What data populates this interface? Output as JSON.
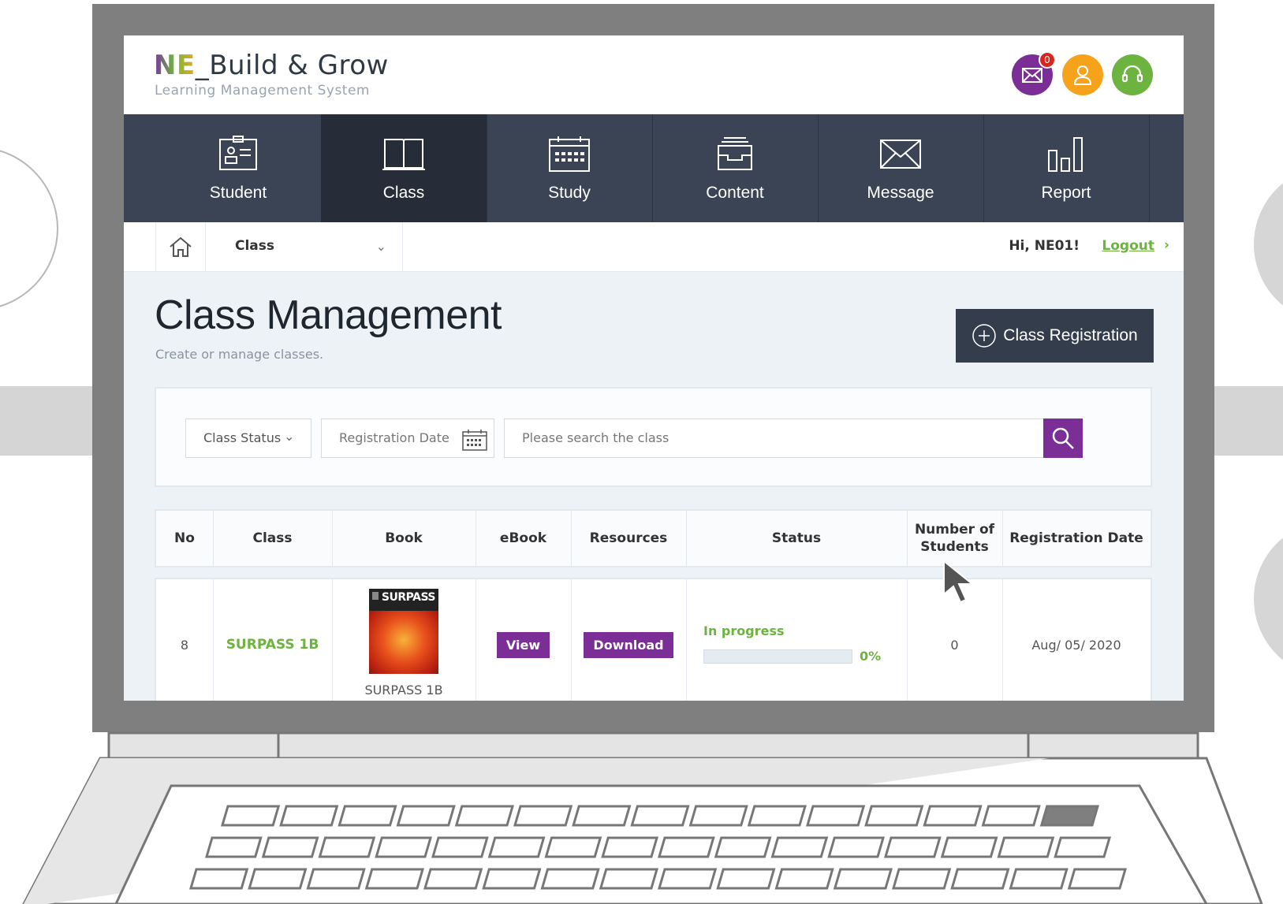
{
  "brand": {
    "logo_mark": "NE",
    "logo_title": "_Build & Grow",
    "logo_subtitle": "Learning Management System",
    "mail_badge_count": "0",
    "colors": {
      "mail": "#7a2e96",
      "profile": "#f7a21b",
      "support": "#6db33f"
    }
  },
  "nav": {
    "items": [
      {
        "label": "Student",
        "icon": "student-card-icon"
      },
      {
        "label": "Class",
        "icon": "book-icon"
      },
      {
        "label": "Study",
        "icon": "calendar-icon"
      },
      {
        "label": "Content",
        "icon": "inbox-tray-icon"
      },
      {
        "label": "Message",
        "icon": "envelope-icon"
      },
      {
        "label": "Report",
        "icon": "bar-chart-icon"
      }
    ],
    "active": "Class"
  },
  "breadcrumb": {
    "current": "Class",
    "greeting": "Hi, NE01!",
    "logout": "Logout"
  },
  "page": {
    "title": "Class Management",
    "subtitle": "Create or manage classes.",
    "register_button": "Class Registration"
  },
  "filters": {
    "status_label": "Class Status",
    "date_label": "Registration Date",
    "search_placeholder": "Please search the class"
  },
  "table": {
    "headers": [
      "No",
      "Class",
      "Book",
      "eBook",
      "Resources",
      "Status",
      "Number of Students",
      "Registration Date"
    ],
    "rows": [
      {
        "no": "8",
        "class": "SURPASS 1B",
        "book_title": "SURPASS 1B",
        "book_cover_title": "SURPASS",
        "ebook_button": "View",
        "resources_button": "Download",
        "status": "In progress",
        "progress_label": "0%",
        "progress": 0,
        "students": "0",
        "registration_date": "Aug/ 05/ 2020"
      }
    ]
  },
  "accent_colors": {
    "purple": "#7a2e96",
    "green": "#6db33f",
    "navy": "#3a4454"
  }
}
